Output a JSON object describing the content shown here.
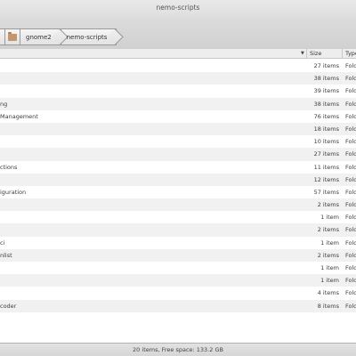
{
  "window": {
    "title": "nemo-scripts"
  },
  "breadcrumb": {
    "items": [
      "gnome2",
      "nemo-scripts"
    ]
  },
  "columns": {
    "size": "Size",
    "type": "Type"
  },
  "rows": [
    {
      "name": "",
      "size": "27 items",
      "type": "Fold"
    },
    {
      "name": "",
      "size": "38 items",
      "type": "Fold"
    },
    {
      "name": "",
      "size": "39 items",
      "type": "Fold"
    },
    {
      "name": "ng",
      "size": "38 items",
      "type": "Fold"
    },
    {
      "name": "Management",
      "size": "76 items",
      "type": "Fold"
    },
    {
      "name": "",
      "size": "18 items",
      "type": "Fold"
    },
    {
      "name": "",
      "size": "10 items",
      "type": "Fold"
    },
    {
      "name": "",
      "size": "27 items",
      "type": "Fold"
    },
    {
      "name": "ctions",
      "size": "11 items",
      "type": "Fold"
    },
    {
      "name": "",
      "size": "12 items",
      "type": "Fold"
    },
    {
      "name": "iguration",
      "size": "57 items",
      "type": "Fold"
    },
    {
      "name": "",
      "size": "2 items",
      "type": "Fold"
    },
    {
      "name": "",
      "size": "1 item",
      "type": "Fold"
    },
    {
      "name": "",
      "size": "2 items",
      "type": "Fold"
    },
    {
      "name": "ci",
      "size": "1 item",
      "type": "Fold"
    },
    {
      "name": "nlist",
      "size": "2 items",
      "type": "Fold"
    },
    {
      "name": "",
      "size": "1 item",
      "type": "Fold"
    },
    {
      "name": "",
      "size": "1 item",
      "type": "Fold"
    },
    {
      "name": "",
      "size": "4 items",
      "type": "Fold"
    },
    {
      "name": "coder",
      "size": "8 items",
      "type": "Fold"
    }
  ],
  "status": {
    "text": "20 items, Free space: 133.2 GB"
  }
}
